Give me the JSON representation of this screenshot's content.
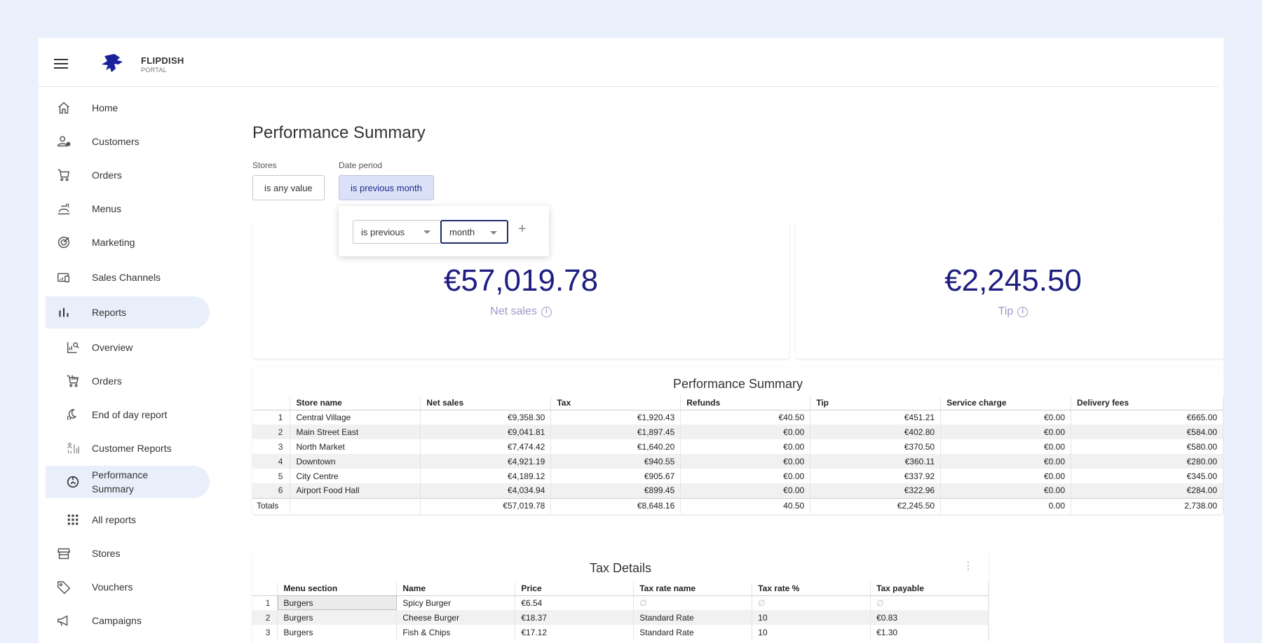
{
  "brand": {
    "name": "FLIPDISH",
    "sub": "PORTAL"
  },
  "sidebar": {
    "items": [
      {
        "label": "Home",
        "icon": "home-icon"
      },
      {
        "label": "Customers",
        "icon": "customers-icon"
      },
      {
        "label": "Orders",
        "icon": "cart-icon"
      },
      {
        "label": "Menus",
        "icon": "menus-icon"
      },
      {
        "label": "Marketing",
        "icon": "target-icon"
      },
      {
        "label": "Sales Channels",
        "icon": "devices-icon"
      },
      {
        "label": "Reports",
        "icon": "bar-chart-icon"
      },
      {
        "label": "Overview",
        "icon": "overview-icon"
      },
      {
        "label": "Orders",
        "icon": "cart-report-icon"
      },
      {
        "label": "End of day report",
        "icon": "end-of-day-icon"
      },
      {
        "label": "Customer Reports",
        "icon": "customer-reports-icon"
      },
      {
        "label": "Performance Summary",
        "icon": "performance-icon"
      },
      {
        "label": "All reports",
        "icon": "grid-icon"
      },
      {
        "label": "Stores",
        "icon": "store-icon"
      },
      {
        "label": "Vouchers",
        "icon": "tag-icon"
      },
      {
        "label": "Campaigns",
        "icon": "megaphone-icon"
      }
    ]
  },
  "page": {
    "title": "Performance Summary"
  },
  "filters": {
    "stores_label": "Stores",
    "stores_value": "is any value",
    "date_label": "Date period",
    "date_value": "is previous month"
  },
  "popover": {
    "operator": "is previous",
    "unit": "month",
    "add": "+"
  },
  "kpis": {
    "net_sales": {
      "value": "€57,019.78",
      "label": "Net sales"
    },
    "tip": {
      "value": "€2,245.50",
      "label": "Tip"
    }
  },
  "summary_table": {
    "title": "Performance Summary",
    "columns": [
      "Store name",
      "Net sales",
      "Tax",
      "Refunds",
      "Tip",
      "Service charge",
      "Delivery fees"
    ],
    "rows": [
      [
        "1",
        "Central Village",
        "€9,358.30",
        "€1,920.43",
        "€40.50",
        "€451.21",
        "€0.00",
        "€665.00"
      ],
      [
        "2",
        "Main Street East",
        "€9,041.81",
        "€1,897.45",
        "€0.00",
        "€402.80",
        "€0.00",
        "€584.00"
      ],
      [
        "3",
        "North Market",
        "€7,474.42",
        "€1,640.20",
        "€0.00",
        "€370.50",
        "€0.00",
        "€580.00"
      ],
      [
        "4",
        "Downtown",
        "€4,921.19",
        "€940.55",
        "€0.00",
        "€360.11",
        "€0.00",
        "€280.00"
      ],
      [
        "5",
        "City Centre",
        "€4,189.12",
        "€905.67",
        "€0.00",
        "€337.92",
        "€0.00",
        "€345.00"
      ],
      [
        "6",
        "Airport Food Hall",
        "€4,034.94",
        "€899.45",
        "€0.00",
        "€322.96",
        "€0.00",
        "€284.00"
      ]
    ],
    "totals": [
      "Totals",
      "",
      "€57,019.78",
      "€8,648.16",
      "40.50",
      "€2,245.50",
      "0.00",
      "2,738.00"
    ]
  },
  "tax_table": {
    "title": "Tax Details",
    "menu_icon": "⋮",
    "columns": [
      "Menu section",
      "Name",
      "Price",
      "Tax rate name",
      "Tax rate %",
      "Tax payable"
    ],
    "rows": [
      [
        "1",
        "Burgers",
        "Spicy Burger",
        "€6.54",
        "∅",
        "∅",
        "∅"
      ],
      [
        "2",
        "Burgers",
        "Cheese Burger",
        "€18.37",
        "Standard Rate",
        "10",
        "€0.83"
      ],
      [
        "3",
        "Burgers",
        "Fish & Chips",
        "€17.12",
        "Standard Rate",
        "10",
        "€1.30"
      ]
    ]
  },
  "colors": {
    "accent": "#1e1e82",
    "active_nav": "#e8effb",
    "page_bg": "#eaf1fd"
  }
}
